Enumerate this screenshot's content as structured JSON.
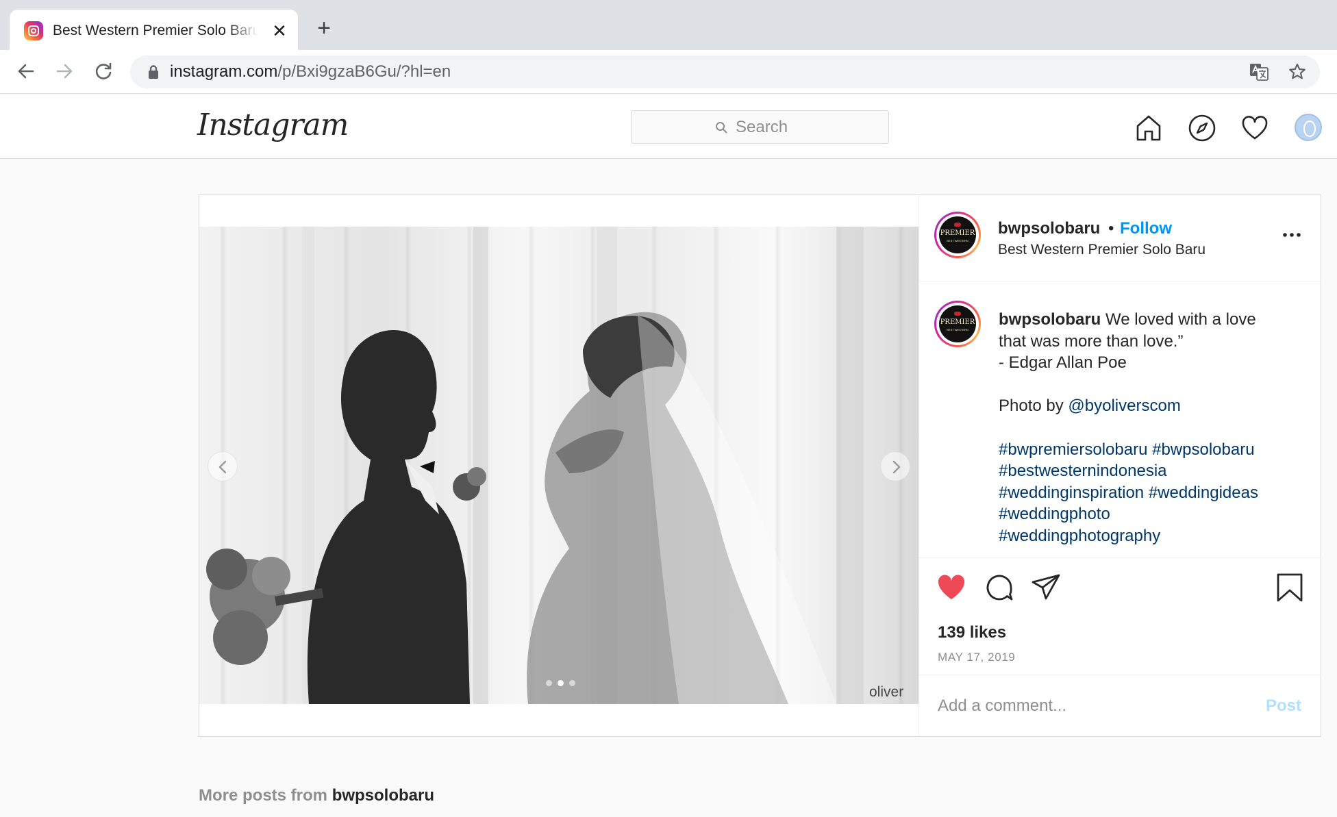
{
  "browser": {
    "tab_title": "Best Western Premier Solo Baru",
    "tab_close": "✕",
    "new_tab": "+",
    "url_host": "instagram.com",
    "url_path": "/p/Bxi9gzaB6Gu/?hl=en"
  },
  "header": {
    "logo_text": "Instagram",
    "search_placeholder": "Search"
  },
  "post": {
    "username": "bwpsolobaru",
    "separator": "•",
    "follow_label": "Follow",
    "location": "Best Western Premier Solo Baru",
    "avatar_logo": {
      "premier": "PREMIER",
      "sub": "BEST WESTERN"
    },
    "image_watermark": "oliver",
    "carousel": {
      "count": 3,
      "active": 2
    },
    "caption": {
      "username": "bwpsolobaru",
      "line1": "We loved with a love",
      "line2": "that was more than love.”",
      "line3": "- Edgar Allan Poe",
      "photo_by": "Photo by ",
      "mention": "@byoliverscom",
      "hashtags_line1": "#bwpremiersolobaru #bwpsolobaru",
      "hashtags_line2": "#bestwesternindonesia",
      "hashtags_line3": "#weddinginspiration #weddingideas",
      "hashtags_line4": "#weddingphoto",
      "hashtags_line5": "#weddingphotography"
    },
    "likes": "139 likes",
    "date": "MAY 17, 2019",
    "comment_placeholder": "Add a comment...",
    "post_button": "Post",
    "liked": true
  },
  "more_posts": {
    "prefix": "More posts from ",
    "username": "bwpsolobaru"
  },
  "colors": {
    "accent_blue": "#0095f6",
    "like_red": "#ed4956",
    "hashtag": "#00376b"
  }
}
